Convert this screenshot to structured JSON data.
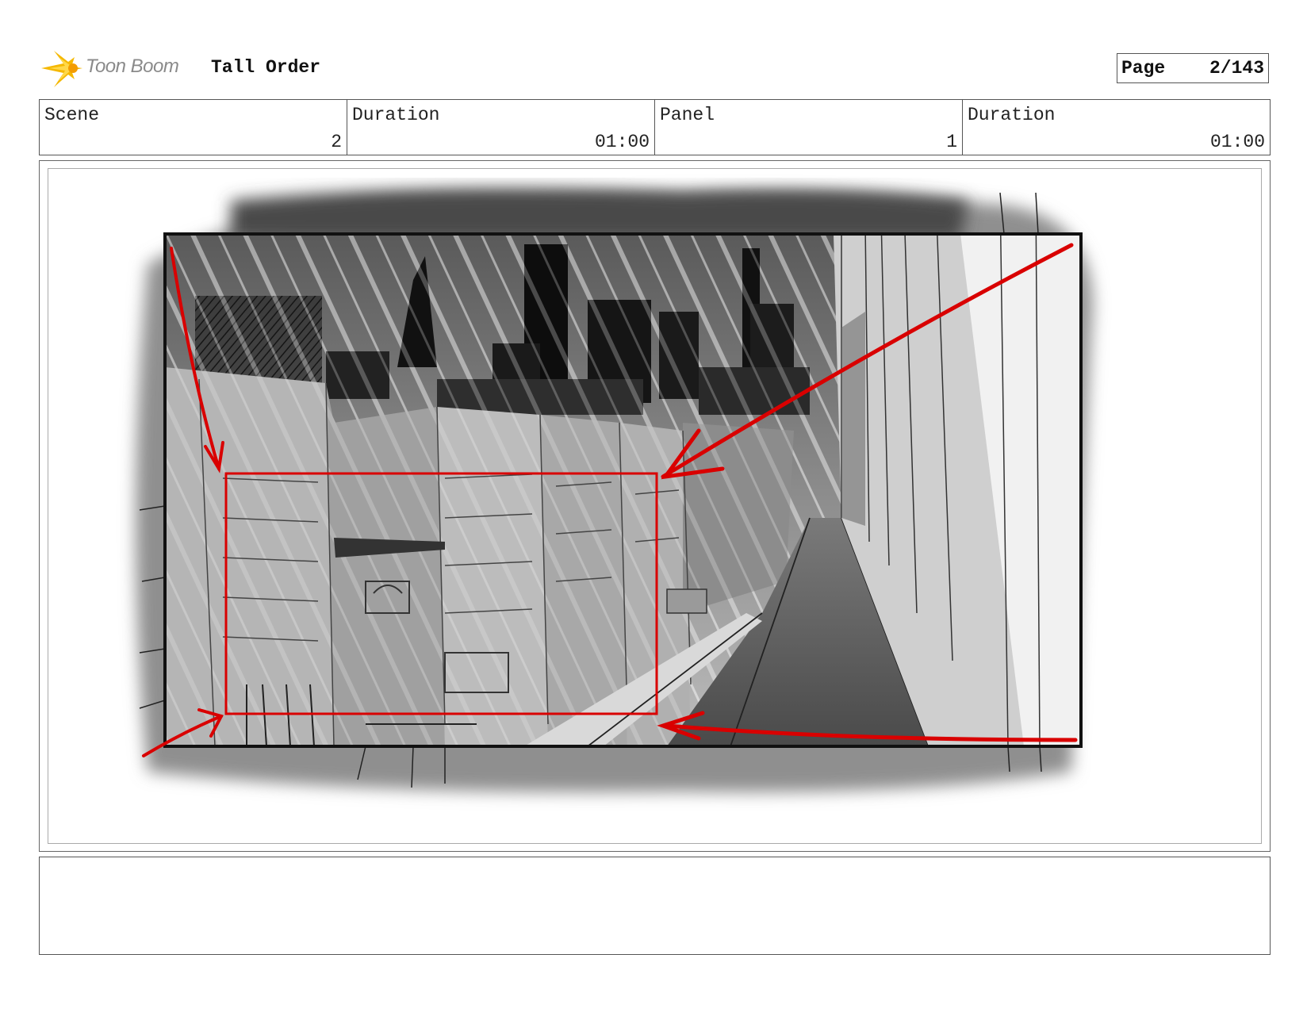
{
  "header": {
    "logo_text": "Toon Boom",
    "project_title": "Tall Order",
    "page_label": "Page",
    "page_value": "2/143"
  },
  "info": {
    "scene_label": "Scene",
    "scene_value": "2",
    "scene_duration_label": "Duration",
    "scene_duration_value": "01:00",
    "panel_label": "Panel",
    "panel_value": "1",
    "panel_duration_label": "Duration",
    "panel_duration_value": "01:00"
  },
  "panel": {
    "drawing": "storyboard-sketch-city-street",
    "annotation_color": "#d90000"
  },
  "notes": {
    "text": ""
  }
}
